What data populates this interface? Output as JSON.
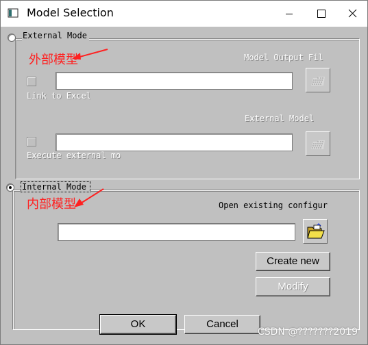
{
  "window": {
    "title": "Model Selection",
    "icons": {
      "app": "app-window-icon",
      "minimize": "minimize-icon",
      "maximize": "maximize-icon",
      "close": "close-icon"
    }
  },
  "external_group": {
    "radio_label": "External Mode",
    "model_output_file_label": "Model Output Fil",
    "link_to_excel_label": "Link to Excel",
    "link_file_value": "",
    "external_model_label": "External Model",
    "execute_external_label": "Execute external mo",
    "exec_file_value": ""
  },
  "internal_group": {
    "radio_label": "Internal Mode",
    "open_existing_label": "Open existing configur",
    "config_path_value": "",
    "create_new_label": "Create new",
    "modify_label": "Modify"
  },
  "annotations": {
    "external": "外部模型",
    "internal": "内部模型",
    "color": "#ff2020"
  },
  "footer": {
    "ok_label": "OK",
    "cancel_label": "Cancel"
  },
  "watermark": "CSDN @???????2019"
}
